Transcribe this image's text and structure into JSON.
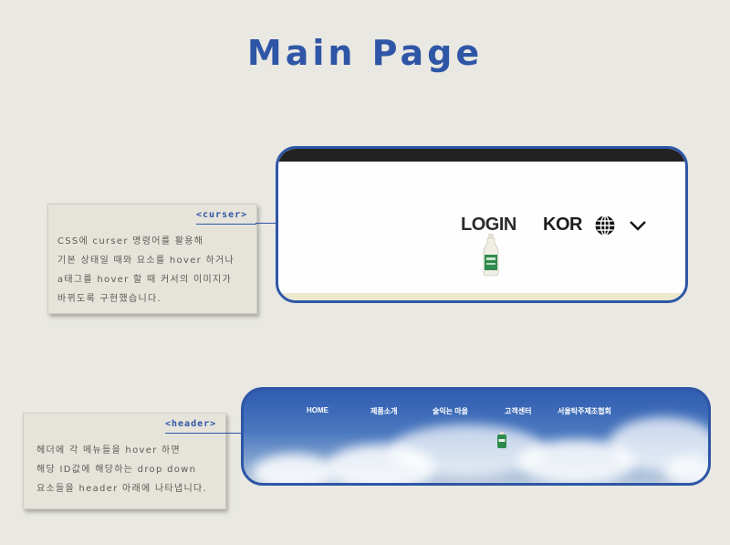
{
  "page": {
    "title": "Main Page"
  },
  "notes": {
    "cursor": {
      "tag": "<curser>",
      "lines": [
        "CSS에 curser 명령어를 활용해",
        "기본 상태일 때와 요소를 hover 하거나",
        "a태그를 hover 할 때 커서의 이미지가",
        "바뀌도록 구현했습니다."
      ]
    },
    "header": {
      "tag": "<header>",
      "lines": [
        "헤더에 각 메뉴들을  hover 하면",
        "해당 ID값에 해당하는 drop down",
        "요소들을 header 아래에 나타냅니다."
      ]
    }
  },
  "cursor_preview": {
    "login_label": "LOGIN",
    "language_label": "KOR",
    "globe_icon": "globe-icon",
    "chevron_icon": "chevron-down-icon",
    "cursor_image": "soju-bottle-cursor"
  },
  "header_preview": {
    "nav": [
      "HOME",
      "제품소개",
      "술익는 마을",
      "고객센터",
      "서울탁주제조협회"
    ],
    "cursor_image": "soju-bottle-cursor"
  },
  "colors": {
    "accent": "#2f56a6",
    "background": "#e9e8e2",
    "note_bg": "#e5e3da"
  }
}
